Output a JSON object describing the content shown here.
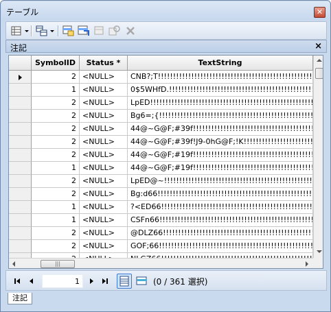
{
  "window": {
    "title": "テーブル",
    "close": "✕"
  },
  "toolbar": {
    "icons": [
      "table-options-icon",
      "related-tables-icon",
      "select-by-attributes-icon",
      "switch-selection-icon",
      "clear-selection-icon",
      "zoom-to-selected-icon",
      "delete-selected-icon"
    ]
  },
  "panel": {
    "title": "注記",
    "close": "×"
  },
  "columns": [
    "",
    "SymbolID",
    "Status *",
    "TextString"
  ],
  "rows": [
    {
      "symbol": "2",
      "status": "<NULL>",
      "text": "CNB?;T!!!!!!!!!!!!!!!!!!!!!!!!!!!!!!!!!!!!!!!!!!!!!!!!!!!!"
    },
    {
      "symbol": "1",
      "status": "<NULL>",
      "text": "0$5WHfD.!!!!!!!!!!!!!!!!!!!!!!!!!!!!!!!!!!!!!!!!!!!!!!!!!!"
    },
    {
      "symbol": "2",
      "status": "<NULL>",
      "text": "LpED!!!!!!!!!!!!!!!!!!!!!!!!!!!!!!!!!!!!!!!!!!!!!!!!!!!!!!!!"
    },
    {
      "symbol": "2",
      "status": "<NULL>",
      "text": "Bg6=;{!!!!!!!!!!!!!!!!!!!!!!!!!!!!!!!!!!!!!!!!!!!!!!!!!!!!!!"
    },
    {
      "symbol": "2",
      "status": "<NULL>",
      "text": "44@~G@F;#39f!!!!!!!!!!!!!!!!!!!!!!!!!!!!!!!!!!!!!!!!!!!!!!"
    },
    {
      "symbol": "2",
      "status": "<NULL>",
      "text": "44@~G@F;#39f!J9-0hG@F;!K!!!!!!!!!!!!!!!!!!!!!!!!!!!!!!!!!!"
    },
    {
      "symbol": "2",
      "status": "<NULL>",
      "text": "44@~G@F;#19f!!!!!!!!!!!!!!!!!!!!!!!!!!!!!!!!!!!!!!!!!!!!!!"
    },
    {
      "symbol": "1",
      "status": "<NULL>",
      "text": "44@~G@F;#19f!!!!!!!!!!!!!!!!!!!!!!!!!!!!!!!!!!!!!!!!!!!!!!"
    },
    {
      "symbol": "2",
      "status": "<NULL>",
      "text": "LpED@~!!!!!!!!!!!!!!!!!!!!!!!!!!!!!!!!!!!!!!!!!!!!!!!!!!!!!"
    },
    {
      "symbol": "2",
      "status": "<NULL>",
      "text": "Bg:d66!!!!!!!!!!!!!!!!!!!!!!!!!!!!!!!!!!!!!!!!!!!!!!!!!!!!!"
    },
    {
      "symbol": "1",
      "status": "<NULL>",
      "text": "?<ED66!!!!!!!!!!!!!!!!!!!!!!!!!!!!!!!!!!!!!!!!!!!!!!!!!!!!!"
    },
    {
      "symbol": "1",
      "status": "<NULL>",
      "text": "CSFn66!!!!!!!!!!!!!!!!!!!!!!!!!!!!!!!!!!!!!!!!!!!!!!!!!!!!!"
    },
    {
      "symbol": "2",
      "status": "<NULL>",
      "text": "@DLZ66!!!!!!!!!!!!!!!!!!!!!!!!!!!!!!!!!!!!!!!!!!!!!!!!!!!!!"
    },
    {
      "symbol": "2",
      "status": "<NULL>",
      "text": "GOF;66!!!!!!!!!!!!!!!!!!!!!!!!!!!!!!!!!!!!!!!!!!!!!!!!!!!!!"
    },
    {
      "symbol": "2",
      "status": "<NULL>",
      "text": "NLGZ66!!!!!!!!!!!!!!!!!!!!!!!!!!!!!!!!!!!!!!!!!!!!!!!!!!!!!"
    }
  ],
  "navigation": {
    "current_record": "1",
    "selection_text": "(0 / 361 選択)"
  },
  "tab": {
    "label": "注記"
  }
}
